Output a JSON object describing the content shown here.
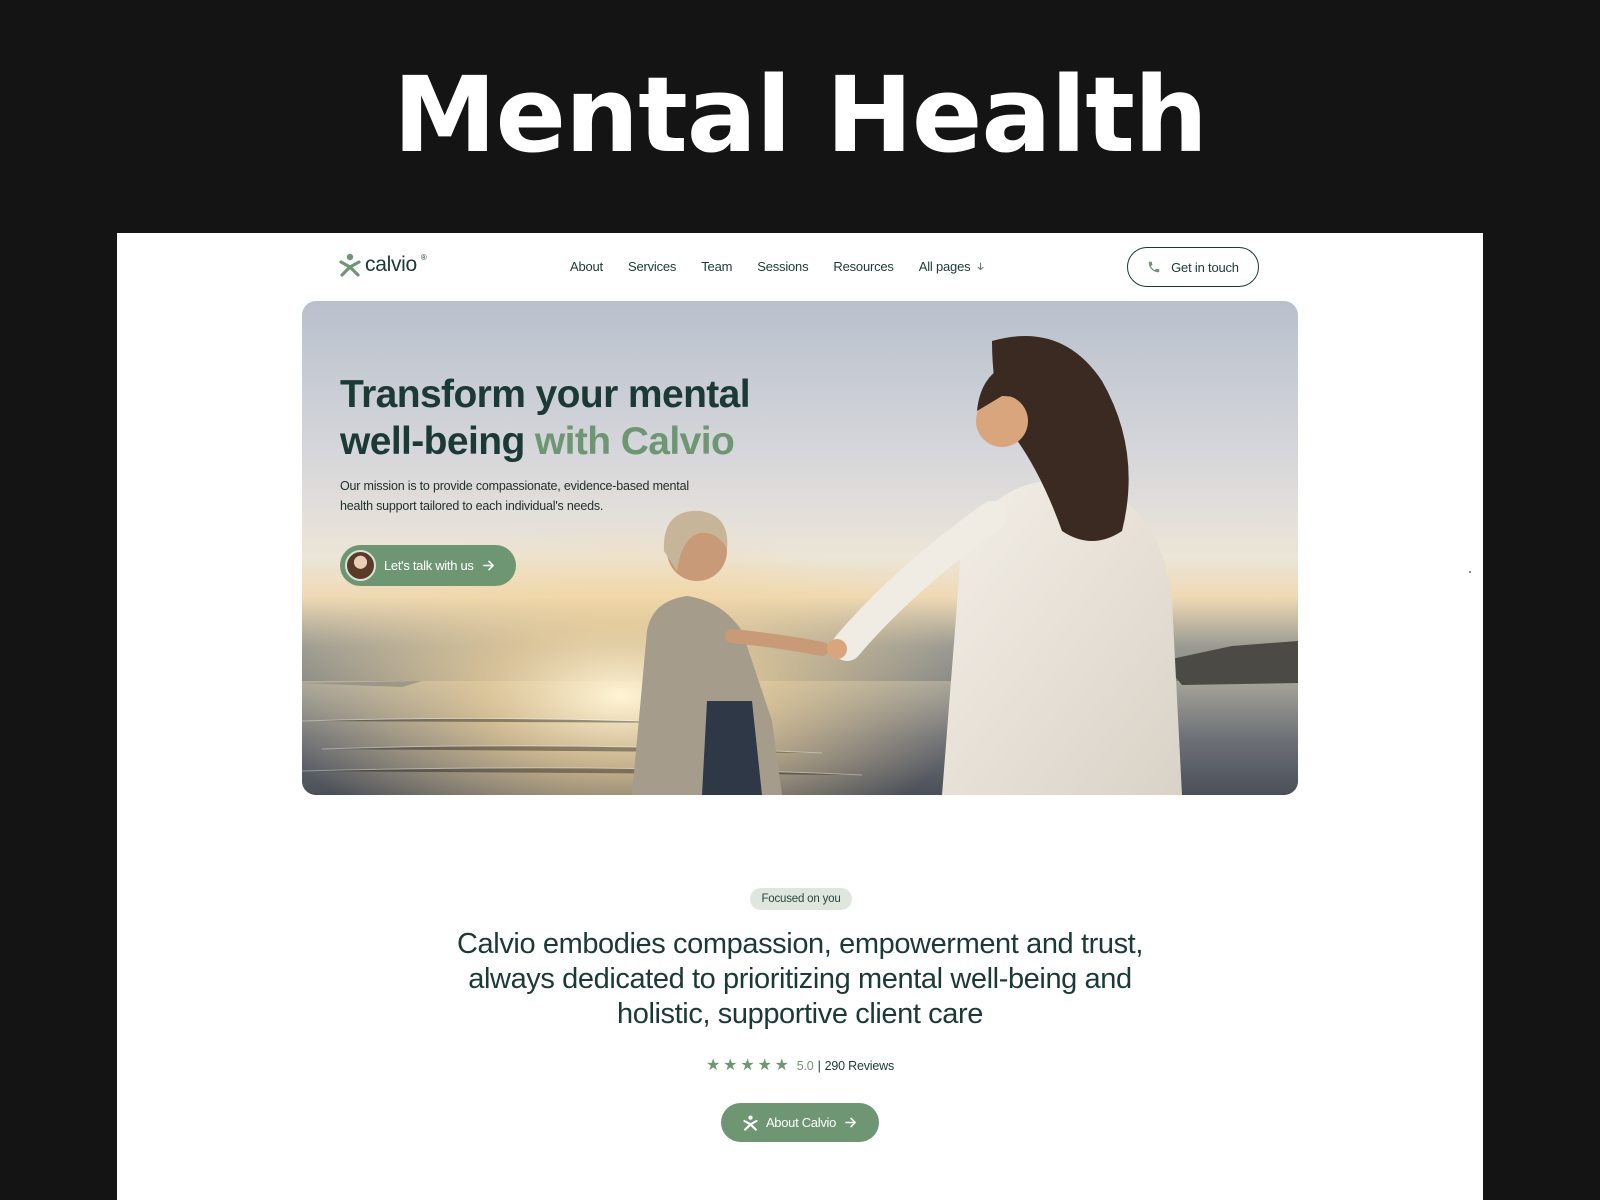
{
  "showcase": {
    "title": "Mental Health"
  },
  "nav": {
    "logo_text": "calvio",
    "logo_reg": "®",
    "links": [
      "About",
      "Services",
      "Team",
      "Sessions",
      "Resources",
      "All pages"
    ],
    "cta_label": "Get in touch"
  },
  "hero": {
    "title_main": "Transform your mental well-being ",
    "title_accent": "with Calvio",
    "subtitle": "Our mission is to provide compassionate, evidence-based mental health support tailored to each individual's needs.",
    "cta_label": "Let's talk with us"
  },
  "intro": {
    "badge": "Focused on you",
    "heading": "Calvio embodies compassion, empowerment and trust, always dedicated to prioritizing mental well-being and holistic, supportive client care",
    "stars": [
      "★",
      "★",
      "★",
      "★",
      "★"
    ],
    "score": "5.0",
    "separator": "|",
    "reviews": "290 Reviews",
    "button_label": "About Calvio"
  },
  "colors": {
    "accent": "#6f9673",
    "dark": "#1c3a35",
    "background": "#141414"
  },
  "icons": [
    "calvio-logo-icon",
    "chevron-down-icon",
    "phone-icon",
    "arrow-right-icon",
    "star-icon"
  ]
}
